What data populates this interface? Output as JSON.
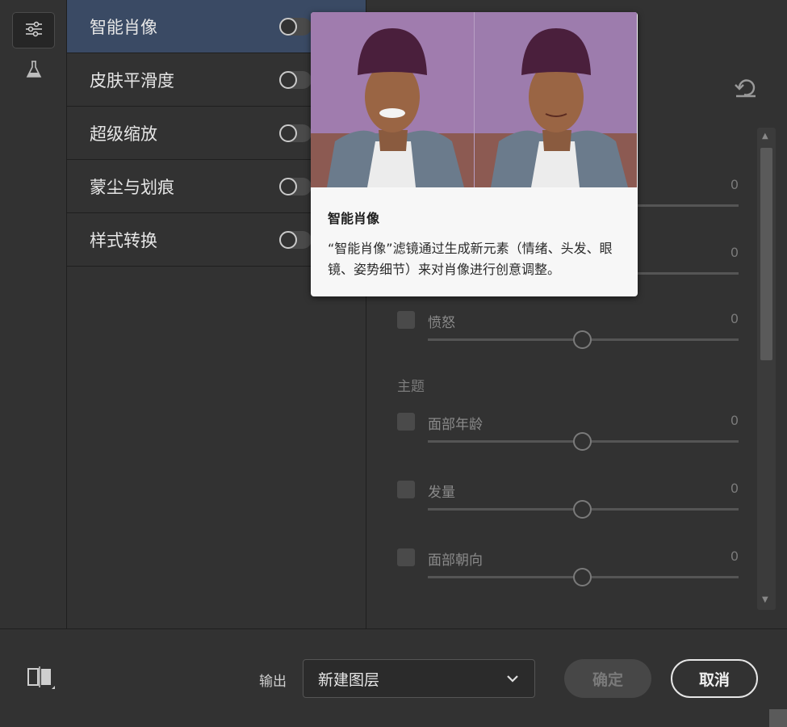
{
  "filters": [
    {
      "label": "智能肖像",
      "selected": true
    },
    {
      "label": "皮肤平滑度",
      "selected": false
    },
    {
      "label": "超级缩放",
      "selected": false
    },
    {
      "label": "蒙尘与划痕",
      "selected": false
    },
    {
      "label": "样式转换",
      "selected": false
    }
  ],
  "tooltip": {
    "title": "智能肖像",
    "description": "“智能肖像”滤镜通过生成新元素（情绪、头发、眼镜、姿势细节）来对肖像进行创意调整。"
  },
  "settings": {
    "hidden_values": [
      "0",
      "0"
    ],
    "sliders": [
      {
        "name": "愤怒",
        "value": "0",
        "level": 0.5
      },
      {
        "name": "面部年龄",
        "value": "0",
        "level": 0.5
      },
      {
        "name": "发量",
        "value": "0",
        "level": 0.5
      },
      {
        "name": "面部朝向",
        "value": "0",
        "level": 0.5
      }
    ],
    "section_theme": "主题"
  },
  "footer": {
    "output_label": "输出",
    "output_value": "新建图层",
    "ok_label": "确定",
    "cancel_label": "取消"
  },
  "colors": {
    "selected_bg": "#3a4a64",
    "photo_bg": "#a07cae",
    "panel_bg": "#323232"
  }
}
